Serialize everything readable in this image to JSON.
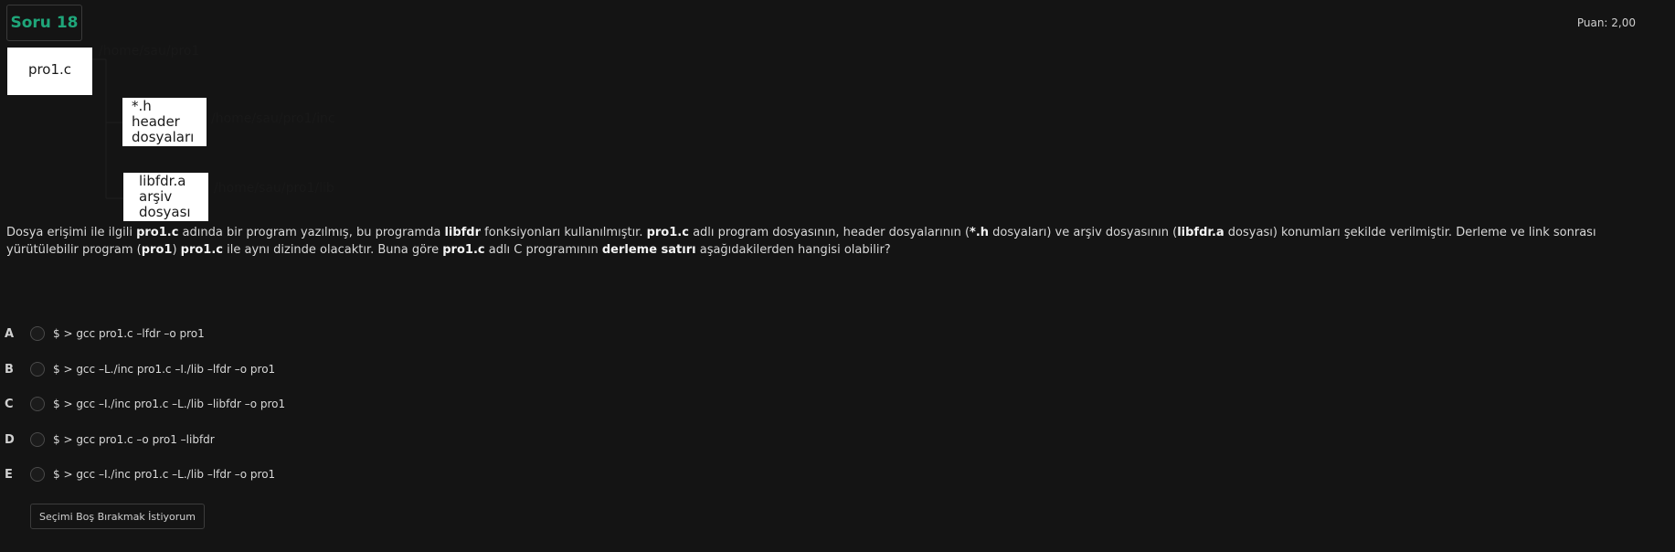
{
  "header": {
    "question_number": "Soru 18",
    "score": "Puan: 2,00"
  },
  "diagram": {
    "main_file": "pro1.c",
    "main_path": "/home/sau/pro1",
    "header_box": {
      "line1": "*.h",
      "line2": "header",
      "line3": "dosyaları"
    },
    "header_path": "/home/sau/pro1/inc",
    "lib_box": {
      "line1": "libfdr.a",
      "line2": "arşiv",
      "line3": "dosyası"
    },
    "lib_path": "/home/sau/pro1/lib"
  },
  "question": {
    "t1": "Dosya erişimi ile ilgili ",
    "b1": "pro1.c",
    "t2": " adında bir program yazılmış, bu programda ",
    "b2": "libfdr",
    "t3": " fonksiyonları kullanılmıştır. ",
    "b3": "pro1.c",
    "t4": " adlı program dosyasının, header dosyalarının (",
    "b4": "*.h",
    "t5": " dosyaları) ve arşiv dosyasının (",
    "b5": "libfdr.a",
    "t6": " dosyası) konumları şekilde verilmiştir. Derleme ve link sonrası yürütülebilir program (",
    "b6": "pro1",
    "t7": ") ",
    "b7": "pro1.c",
    "t8": " ile aynı dizinde olacaktır. Buna göre ",
    "b8": "pro1.c",
    "t9": " adlı C programının ",
    "b9": "derleme satırı",
    "t10": " aşağıdakilerden hangisi olabilir?"
  },
  "options": [
    {
      "letter": "A",
      "text": "$ > gcc pro1.c –lfdr –o pro1"
    },
    {
      "letter": "B",
      "text": "$ > gcc –L./inc pro1.c –I./lib –lfdr –o pro1"
    },
    {
      "letter": "C",
      "text": "$ > gcc –I./inc pro1.c –L./lib –libfdr –o pro1"
    },
    {
      "letter": "D",
      "text": "$ > gcc pro1.c –o pro1 –libfdr"
    },
    {
      "letter": "E",
      "text": "$ > gcc –I./inc pro1.c –L./lib –lfdr –o pro1"
    }
  ],
  "skip_button": "Seçimi Boş Bırakmak İstiyorum"
}
